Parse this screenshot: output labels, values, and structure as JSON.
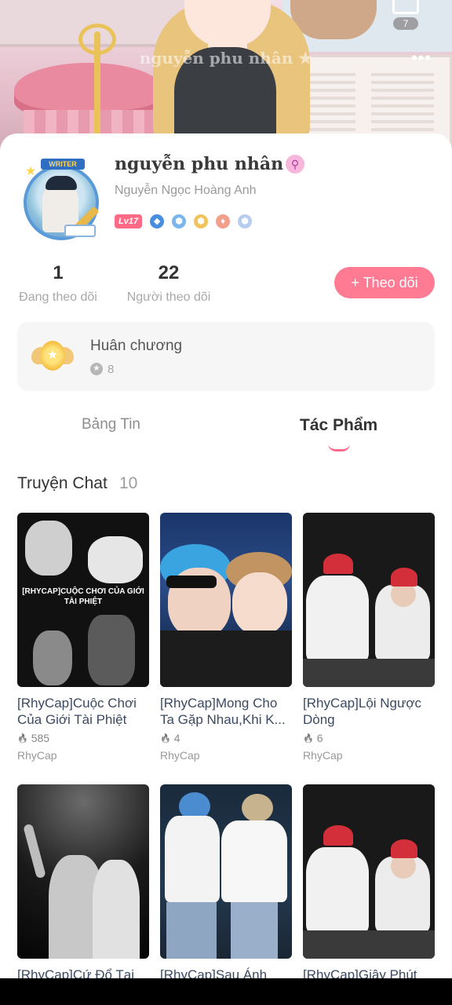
{
  "banner": {
    "name_watermark": "nguyễn phu nhân ★",
    "top_count": "7",
    "more_label": "•••"
  },
  "profile": {
    "writer_badge": "WRITER",
    "display_name": "nguyễn phu nhân ★",
    "real_name": "Nguyễn Ngọc Hoàng Anh",
    "level": "Lv17",
    "following_count": "1",
    "following_label": "Đang theo dõi",
    "followers_count": "22",
    "followers_label": "Người theo dõi",
    "follow_button": "+ Theo dõi"
  },
  "medals": {
    "title": "Huân chương",
    "count": "8"
  },
  "tabs": [
    {
      "label": "Bảng Tin",
      "active": false
    },
    {
      "label": "Tác Phẩm",
      "active": true
    }
  ],
  "section": {
    "title": "Truyện Chat",
    "count": "10"
  },
  "stories": [
    {
      "title": "[RhyCap]Cuộc Chơi Của Giới Tài Phiệt",
      "reads": "585",
      "author": "RhyCap",
      "cover_text": "[RHYCAP]CUỘC CHƠI CỦA GIỚI TÀI PHIỆT"
    },
    {
      "title": "[RhyCap]Mong Cho Ta Gặp Nhau,Khi K...",
      "reads": "4",
      "author": "RhyCap"
    },
    {
      "title": "[RhyCap]Lội Ngược Dòng",
      "reads": "6",
      "author": "RhyCap"
    },
    {
      "title": "[RhyCap]Cứ Đổ Tại",
      "reads": "",
      "author": ""
    },
    {
      "title": "[RhyCap]Sau Ánh",
      "reads": "",
      "author": ""
    },
    {
      "title": "[RhyCap]Giây Phút",
      "reads": "",
      "author": ""
    }
  ],
  "icons": {
    "flame": "🔥",
    "verify": "⚲"
  },
  "colors": {
    "accent": "#ff7a93",
    "title_text": "#3b4a60"
  }
}
